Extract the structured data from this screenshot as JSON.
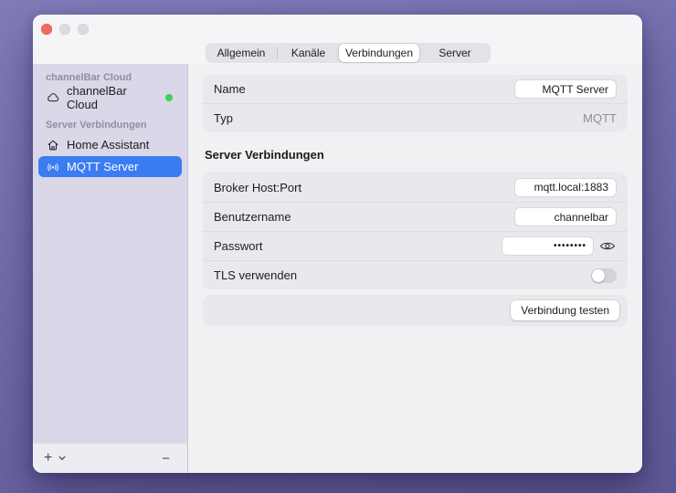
{
  "colors": {
    "desktop_purple": "#716cab",
    "sidebar_lavender": "#d9d7e8",
    "accent_blue": "#3b7cf3",
    "status_green": "#3ed15e",
    "close_red": "#ed6b5f",
    "group_box": "#e9e8ec"
  },
  "icons": [
    "close-icon",
    "minimize-icon",
    "zoom-icon",
    "cloud-icon",
    "home-icon",
    "antenna-icon",
    "eye-icon",
    "plus-icon",
    "chevron-down-icon",
    "minus-icon"
  ],
  "titlebar": {
    "tabs": [
      {
        "label": "Allgemein",
        "selected": false
      },
      {
        "label": "Kanäle",
        "selected": false
      },
      {
        "label": "Verbindungen",
        "selected": true
      },
      {
        "label": "Server",
        "selected": false
      }
    ]
  },
  "sidebar": {
    "sections": [
      {
        "header": "channelBar Cloud",
        "items": [
          {
            "label": "channelBar Cloud",
            "icon": "cloud-icon",
            "online": true,
            "selected": false
          }
        ]
      },
      {
        "header": "Server Verbindungen",
        "items": [
          {
            "label": "Home Assistant",
            "icon": "home-icon",
            "selected": false
          },
          {
            "label": "MQTT Server",
            "icon": "antenna-icon",
            "selected": true
          }
        ]
      }
    ],
    "footer": {
      "add": "+",
      "remove": "−"
    }
  },
  "form": {
    "name": {
      "label": "Name",
      "value": "MQTT Server"
    },
    "typ": {
      "label": "Typ",
      "value": "MQTT"
    },
    "section_title": "Server Verbindungen",
    "broker": {
      "label": "Broker Host:Port",
      "value": "mqtt.local:1883"
    },
    "username": {
      "label": "Benutzername",
      "value": "channelbar"
    },
    "password": {
      "label": "Passwort",
      "value": "••••••••"
    },
    "tls": {
      "label": "TLS verwenden",
      "enabled": false
    },
    "test_button": "Verbindung testen"
  }
}
